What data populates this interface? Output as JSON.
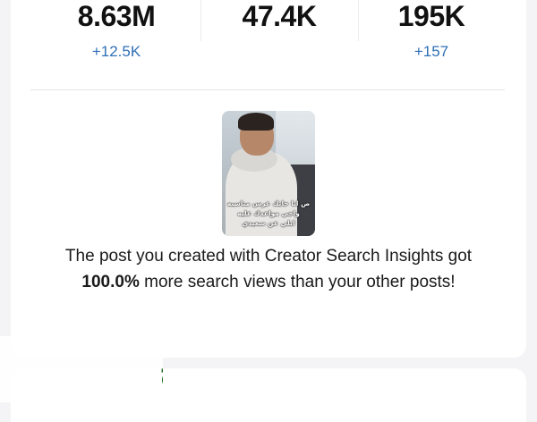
{
  "stats": [
    {
      "value": "8.63M",
      "delta": "+12.5K"
    },
    {
      "value": "47.4K",
      "delta": ""
    },
    {
      "value": "195K",
      "delta": "+157"
    }
  ],
  "video": {
    "caption_line1": "ص انا حابك عرس مناسبه",
    "caption_line2": "واجي مواعدك عليه",
    "caption_line3": "ابلي عن سعيدي"
  },
  "message": {
    "prefix": "The post you created with Creator Search Insights got ",
    "highlight": "100.0%",
    "suffix": " more search views than your other posts!"
  },
  "watermark": {
    "text": "موقع حراج",
    "color": "#1f6b1f"
  },
  "colors": {
    "delta": "#2f6fb7",
    "background": "#f4f4f6",
    "card": "#ffffff"
  }
}
